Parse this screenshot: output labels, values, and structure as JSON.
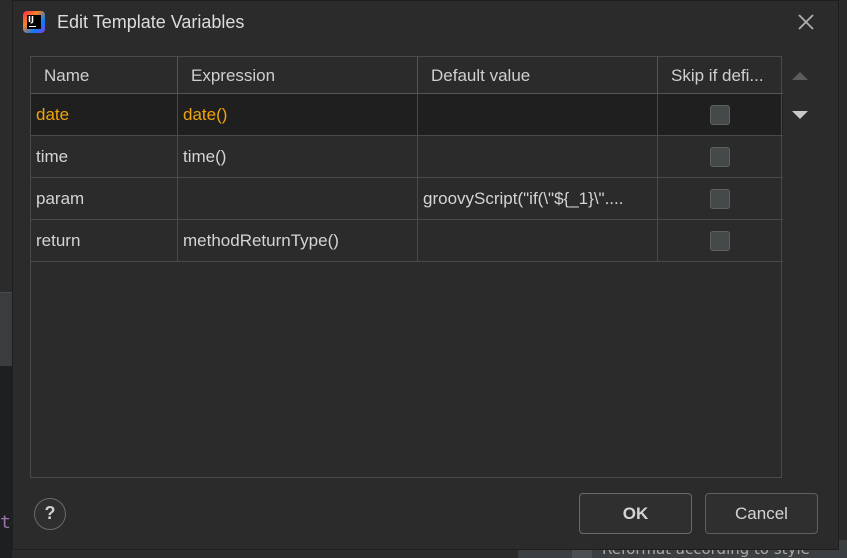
{
  "background": {
    "glyph": "t",
    "reformat_label": "Reformat according to style"
  },
  "dialog": {
    "title": "Edit Template Variables",
    "close_icon": "close-icon",
    "app_icon": "intellij-idea-icon",
    "app_icon_text": "IJ"
  },
  "table": {
    "columns": [
      "Name",
      "Expression",
      "Default value",
      "Skip if defi..."
    ],
    "rows": [
      {
        "name": "date",
        "expression": "date()",
        "default": "",
        "skip": false,
        "selected": true
      },
      {
        "name": "time",
        "expression": "time()",
        "default": "",
        "skip": false,
        "selected": false
      },
      {
        "name": "param",
        "expression": "",
        "default": "groovyScript(\"if(\\\"${_1}\\\"....",
        "skip": false,
        "selected": false
      },
      {
        "name": "return",
        "expression": "methodReturnType()",
        "default": "",
        "skip": false,
        "selected": false
      }
    ]
  },
  "side_buttons": {
    "up_icon": "triangle-up-icon",
    "down_icon": "triangle-down-icon"
  },
  "footer": {
    "help_label": "?",
    "ok_label": "OK",
    "cancel_label": "Cancel"
  },
  "colors": {
    "selected_text": "#f0a30a",
    "dialog_bg": "#2b2b2b"
  }
}
